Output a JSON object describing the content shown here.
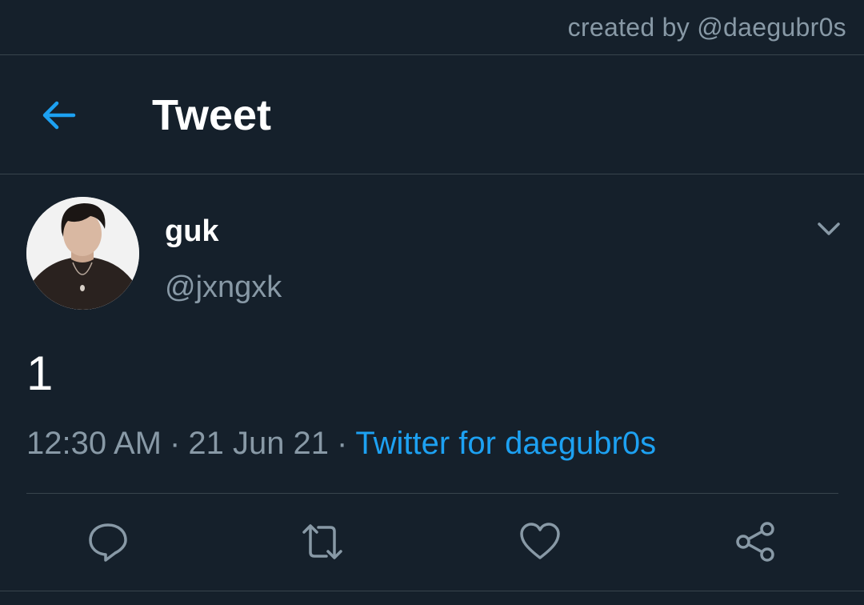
{
  "credit": {
    "text": "created by @daegubr0s"
  },
  "header": {
    "title": "Tweet",
    "back_icon": "arrow-left-icon"
  },
  "tweet": {
    "author": {
      "display_name": "guk",
      "handle": "@jxngxk",
      "avatar": "profile-photo"
    },
    "text": "1",
    "time": "12:30 AM",
    "separator": "·",
    "date": "21 Jun 21",
    "source": "Twitter for daegubr0s",
    "menu_icon": "chevron-down-icon"
  },
  "actions": {
    "reply_icon": "reply-icon",
    "retweet_icon": "retweet-icon",
    "like_icon": "heart-icon",
    "share_icon": "share-icon"
  },
  "colors": {
    "background": "#15202b",
    "accent": "#1da1f2",
    "muted": "#8899a6",
    "divider": "#38444d"
  }
}
